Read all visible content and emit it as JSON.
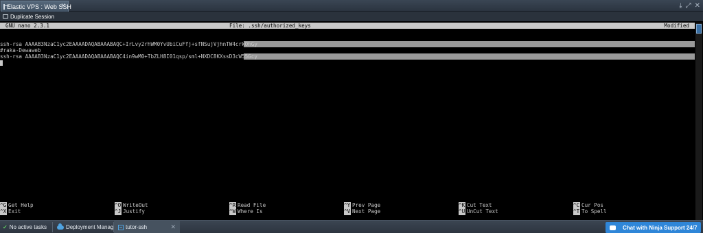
{
  "window": {
    "tab_title": "Elastic VPS : Web SSH",
    "tab_close": "✕",
    "controls": [
      "⤓",
      "⤢",
      "✕"
    ]
  },
  "toolbar": {
    "duplicate_label": "Duplicate Session"
  },
  "nano": {
    "version": "GNU nano 2.3.1",
    "file_label": "File: .ssh/authorized_keys",
    "status": "Modified"
  },
  "file_lines": [
    "ssh-rsa AAAAB3NzaC1yc2EAAAADAQABAAABAQC+IrLvy2rhWM0YvUbiCuFfj+sfNSujVjhnTW4crkOhGy",
    "#raka-Dewaweb",
    "ssh-rsa AAAAB3NzaC1yc2EAAAADAQABAAABAQC4in9wM0+TbZLH8I01qsp/sml+NXDC8KXssD3cW55Gcy"
  ],
  "shortcuts": [
    [
      {
        "key": "^G",
        "label": "Get Help"
      },
      {
        "key": "^O",
        "label": "WriteOut"
      },
      {
        "key": "^R",
        "label": "Read File"
      },
      {
        "key": "^Y",
        "label": "Prev Page"
      },
      {
        "key": "^K",
        "label": "Cut Text"
      },
      {
        "key": "^C",
        "label": "Cur Pos"
      }
    ],
    [
      {
        "key": "^X",
        "label": "Exit"
      },
      {
        "key": "^J",
        "label": "Justify"
      },
      {
        "key": "^W",
        "label": "Where Is"
      },
      {
        "key": "^V",
        "label": "Next Page"
      },
      {
        "key": "^U",
        "label": "UnCut Text"
      },
      {
        "key": "^T",
        "label": "To Spell"
      }
    ]
  ],
  "statusbar": {
    "tasks": "No active tasks",
    "deployment_manager": "Deployment Manager",
    "ssh_tab": "tutor-ssh",
    "ssh_tab_close": "✕",
    "chat": "Chat with Ninja Support 24/7"
  },
  "colors": {
    "terminal_bg": "#000000",
    "nano_bar": "#c8c8c8",
    "selection": "#9a9a9a",
    "chat_button": "#2f86d8"
  }
}
